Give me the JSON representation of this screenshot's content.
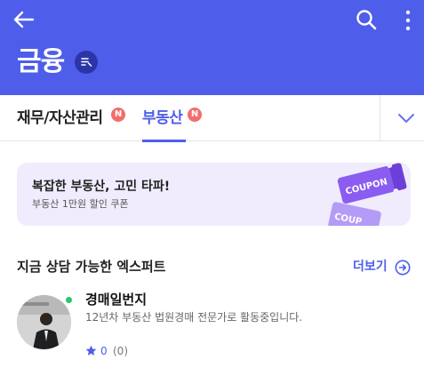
{
  "colors": {
    "brand": "#4e5eea",
    "brand_dark": "#2c35a8",
    "badge_new": "#f26d6d",
    "banner_bg": "#f0ecfd",
    "coupon": "#8a5cf0",
    "online": "#26c96b"
  },
  "header": {
    "title": "금융",
    "back_icon": "arrow-left-icon",
    "search_icon": "search-icon",
    "more_icon": "more-vertical-icon",
    "title_badge_icon": "list-icon"
  },
  "tabs": [
    {
      "label": "재무/자산관리",
      "badge": "N",
      "active": false
    },
    {
      "label": "부동산",
      "badge": "N",
      "active": true
    }
  ],
  "tab_expand_icon": "chevron-down-icon",
  "banner": {
    "title": "복잡한 부동산, 고민 타파!",
    "subtitle": "부동산 1만원 할인 쿠폰",
    "coupon_text": "COUPON",
    "coupon_text_2": "COUP"
  },
  "experts_section": {
    "title": "지금 상담 가능한 엑스퍼트",
    "more_label": "더보기",
    "more_icon": "arrow-right-circle-icon"
  },
  "expert": {
    "name": "경매일번지",
    "description": "12년차 부동산 법원경매 전문가로 활동중입니다.",
    "rating": "0",
    "review_count": "(0)",
    "online": true
  }
}
